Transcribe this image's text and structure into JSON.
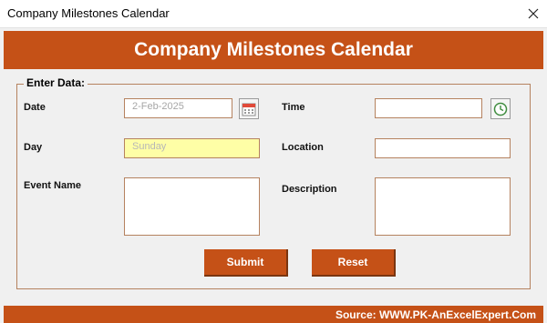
{
  "window": {
    "title": "Company Milestones Calendar",
    "close_icon": "close-icon"
  },
  "banner": {
    "title": "Company Milestones Calendar"
  },
  "form": {
    "group_label": "Enter Data:",
    "date": {
      "label": "Date",
      "value": "2-Feb-2025",
      "icon": "calendar-icon"
    },
    "day": {
      "label": "Day",
      "value": "Sunday"
    },
    "event_name": {
      "label": "Event Name",
      "value": ""
    },
    "time": {
      "label": "Time",
      "value": "",
      "icon": "clock-icon"
    },
    "location": {
      "label": "Location",
      "value": ""
    },
    "description": {
      "label": "Description",
      "value": ""
    }
  },
  "buttons": {
    "submit": "Submit",
    "reset": "Reset"
  },
  "footer": {
    "source": "Source: WWW.PK-AnExcelExpert.Com"
  },
  "colors": {
    "accent": "#c55117",
    "field_border": "#b5825f",
    "day_fill": "#fefea6"
  }
}
